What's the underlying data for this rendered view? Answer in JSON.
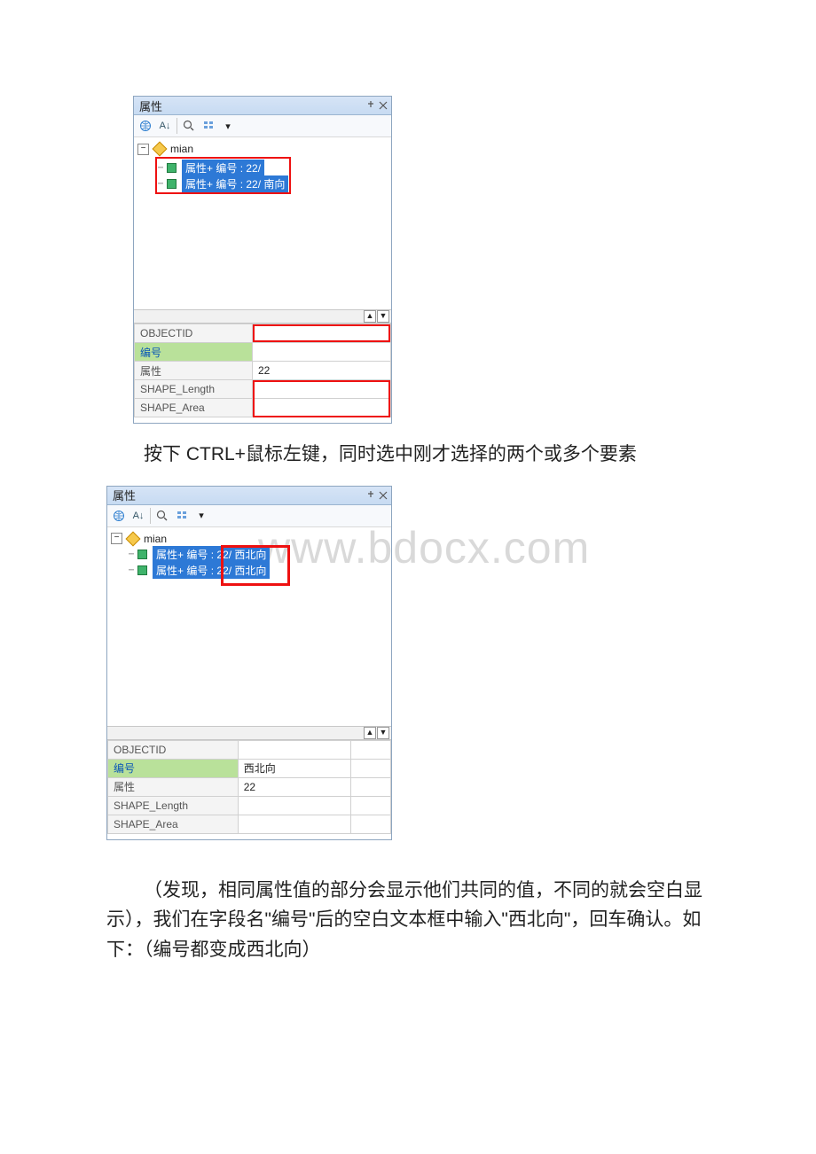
{
  "watermark": "www.bdocx.com",
  "panel1": {
    "title": "属性",
    "tree_root": "mian",
    "items": [
      {
        "label": "属性+ 编号 : 22/"
      },
      {
        "label": "属性+ 编号 : 22/ 南向"
      }
    ],
    "rows": {
      "objectid": {
        "k": "OBJECTID",
        "v": ""
      },
      "bianhao": {
        "k": "编号",
        "v": ""
      },
      "shuxing": {
        "k": "属性",
        "v": "22"
      },
      "slen": {
        "k": "SHAPE_Length",
        "v": ""
      },
      "sarea": {
        "k": "SHAPE_Area",
        "v": ""
      }
    }
  },
  "text1": "按下 CTRL+鼠标左键，同时选中刚才选择的两个或多个要素",
  "panel2": {
    "title": "属性",
    "tree_root": "mian",
    "items": [
      {
        "prefix": "属性+ 编号 : ",
        "suffix": "22/ 西北向"
      },
      {
        "prefix": "属性+ 编号 : ",
        "suffix": "22/ 西北向"
      }
    ],
    "rows": {
      "objectid": {
        "k": "OBJECTID",
        "v": ""
      },
      "bianhao": {
        "k": "编号",
        "v": "西北向"
      },
      "shuxing": {
        "k": "属性",
        "v": "22"
      },
      "slen": {
        "k": "SHAPE_Length",
        "v": ""
      },
      "sarea": {
        "k": "SHAPE_Area",
        "v": ""
      }
    }
  },
  "text2": "（发现，相同属性值的部分会显示他们共同的值，不同的就会空白显示），我们在字段名\"编号\"后的空白文本框中输入\"西北向\"，回车确认。如下：（编号都变成西北向）"
}
